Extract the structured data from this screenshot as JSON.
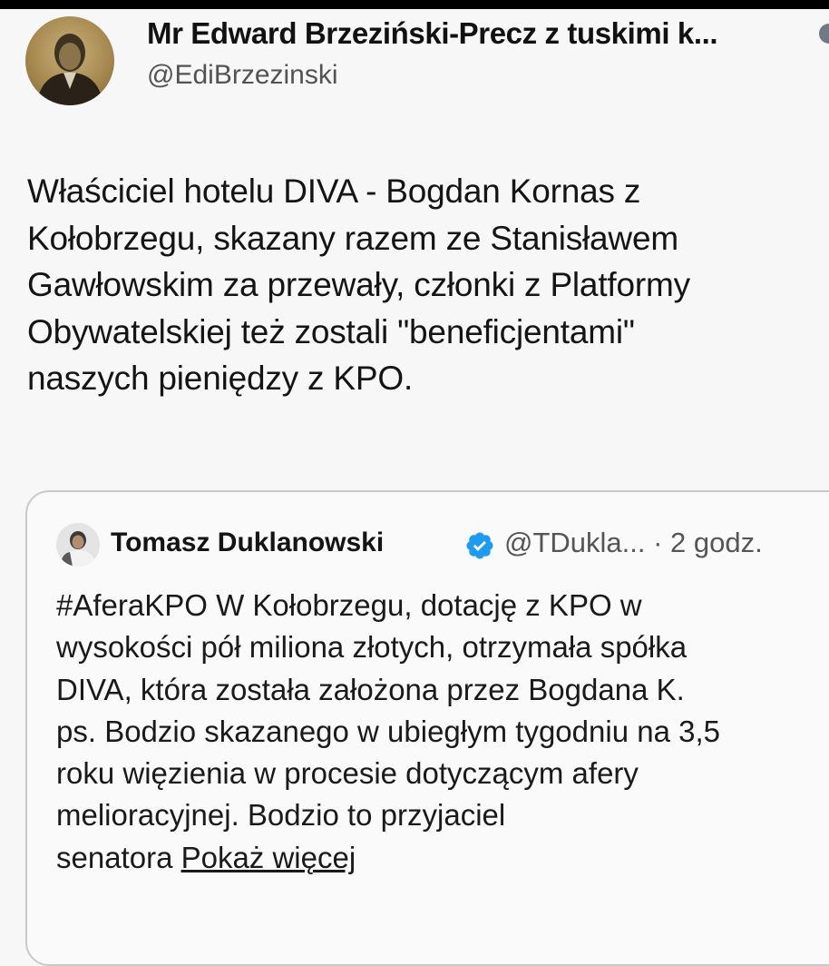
{
  "tweet": {
    "author_name": "Mr Edward Brzeziński-Precz z tuskimi k...",
    "handle": "@EdiBrzezinski",
    "text_lines": [
      "Właściciel hotelu DIVA - Bogdan Kornas z",
      "Kołobrzegu, skazany razem ze Stanisławem",
      "Gawłowskim za przewały, członki z Platformy",
      "Obywatelskiej też zostali \"beneficjentami\"",
      "naszych pieniędzy z KPO."
    ]
  },
  "quoted_tweet": {
    "author_name": "Tomasz Duklanowski",
    "handle_time": "@TDukla... · 2 godz.",
    "text_lines": [
      "#AferaKPO  W Kołobrzegu, dotację z KPO w",
      "wysokości pół miliona złotych, otrzymała spółka",
      "DIVA, która została założona przez Bogdana K.",
      "ps. Bodzio skazanego w ubiegłym tygodniu na 3,5",
      "roku więzienia w procesie dotyczącym afery",
      "melioracyjnej. Bodzio to przyjaciel"
    ],
    "last_line_prefix": "senatora ",
    "show_more": "Pokaż więcej"
  },
  "icons": {
    "author_avatar": "avatar-photo",
    "quoted_avatar": "avatar-photo",
    "verified": "verified-badge-icon",
    "truncated_badge": "badge-icon"
  },
  "colors": {
    "verified_badge": "#1d9bf0",
    "handle_gray": "#535353",
    "card_border": "#c9c9c9"
  }
}
